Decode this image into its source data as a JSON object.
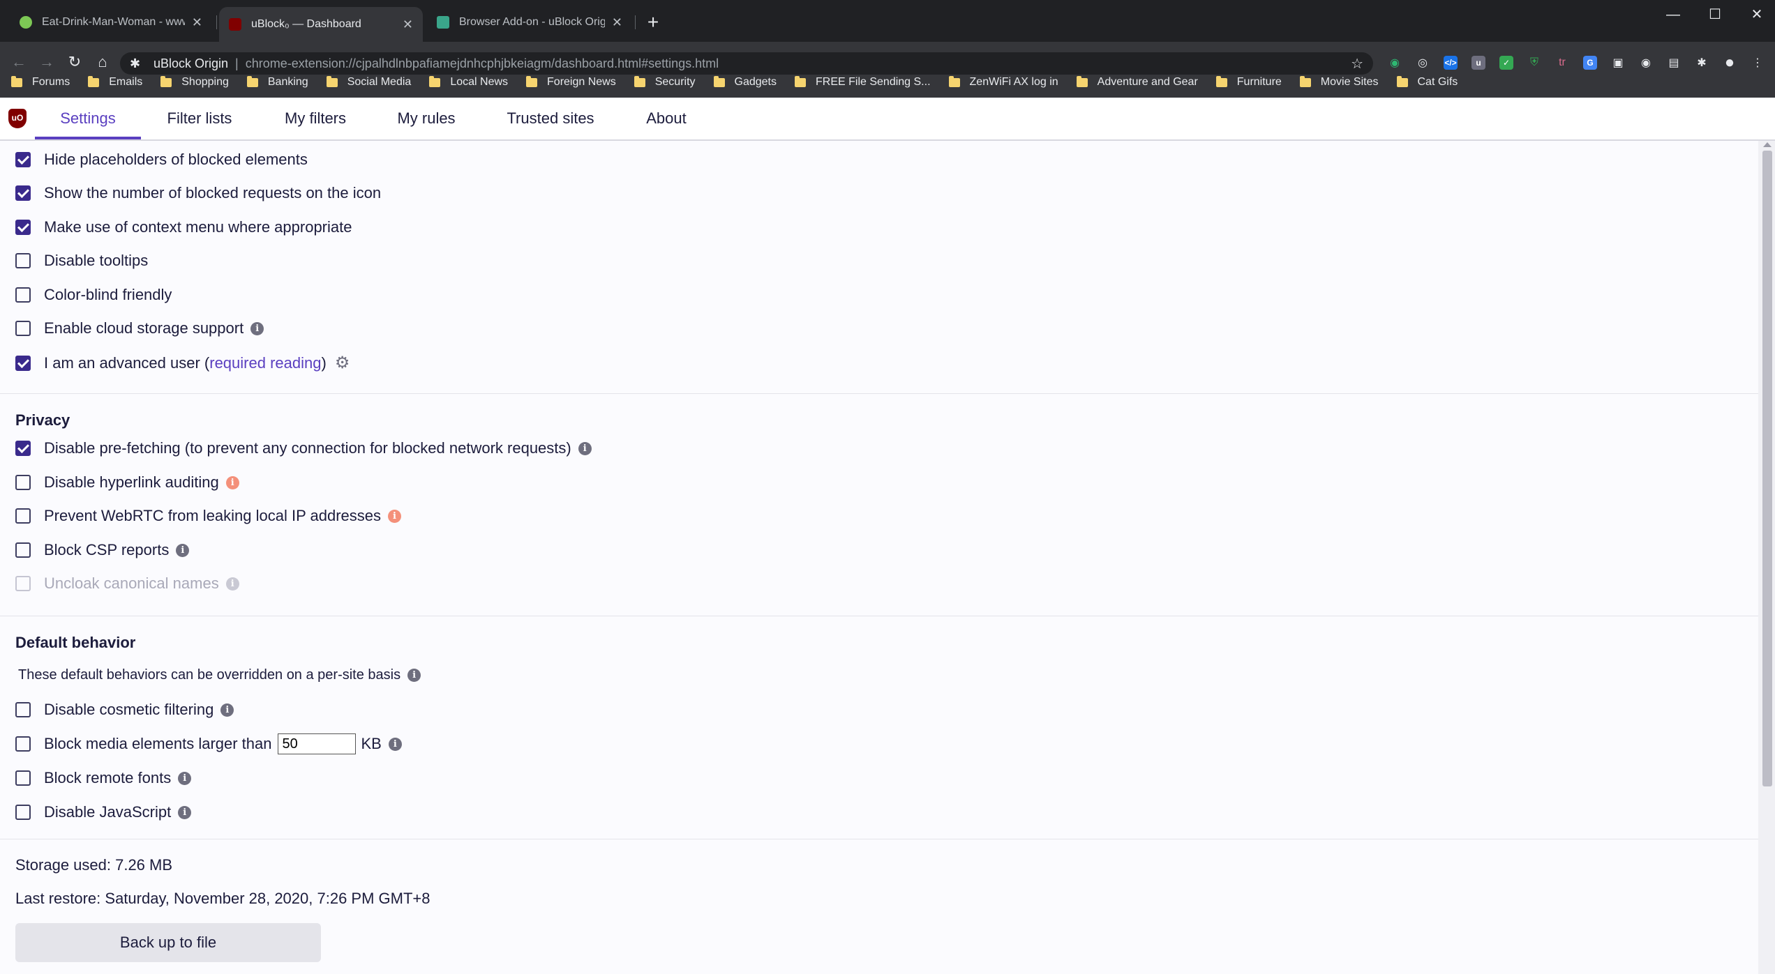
{
  "browser": {
    "tabs": [
      {
        "title": "Eat-Drink-Man-Woman - www.h...",
        "active": false
      },
      {
        "title": "uBlock₀ — Dashboard",
        "active": true
      },
      {
        "title": "Browser Add-on - uBlock Origin",
        "active": false
      }
    ],
    "new_tab": "+",
    "window_controls": {
      "minimize": "—",
      "maximize": "☐",
      "close": "✕"
    },
    "omnibox": {
      "site": "uBlock Origin",
      "divider": "|",
      "url": "chrome-extension://cjpalhdlnbpafiamejdnhcphjbkeiagm/dashboard.html#settings.html"
    },
    "bookmarks": [
      "Forums",
      "Emails",
      "Shopping",
      "Banking",
      "Social Media",
      "Local News",
      "Foreign News",
      "Security",
      "Gadgets",
      "FREE File Sending S...",
      "ZenWiFi AX log in",
      "Adventure and Gear",
      "Furniture",
      "Movie Sites",
      "Cat Gifs"
    ]
  },
  "dashboard": {
    "logo": "uO",
    "tabs": [
      {
        "label": "Settings",
        "active": true
      },
      {
        "label": "Filter lists",
        "active": false
      },
      {
        "label": "My filters",
        "active": false
      },
      {
        "label": "My rules",
        "active": false
      },
      {
        "label": "Trusted sites",
        "active": false
      },
      {
        "label": "About",
        "active": false
      }
    ]
  },
  "appearance": {
    "options": [
      {
        "label": "Hide placeholders of blocked elements",
        "checked": true
      },
      {
        "label": "Show the number of blocked requests on the icon",
        "checked": true
      },
      {
        "label": "Make use of context menu where appropriate",
        "checked": true
      },
      {
        "label": "Disable tooltips",
        "checked": false
      },
      {
        "label": "Color-blind friendly",
        "checked": false
      },
      {
        "label": "Enable cloud storage support",
        "checked": false
      },
      {
        "label": "I am an advanced user (",
        "link": "required reading",
        "suffix": ")",
        "checked": true
      }
    ]
  },
  "privacy": {
    "heading": "Privacy",
    "options": [
      {
        "label": "Disable pre-fetching (to prevent any connection for blocked network requests)",
        "checked": true
      },
      {
        "label": "Disable hyperlink auditing",
        "checked": false
      },
      {
        "label": "Prevent WebRTC from leaking local IP addresses",
        "checked": false
      },
      {
        "label": "Block CSP reports",
        "checked": false
      },
      {
        "label": "Uncloak canonical names",
        "checked": false,
        "disabled": true
      }
    ]
  },
  "default_behavior": {
    "heading": "Default behavior",
    "note": "These default behaviors can be overridden on a per-site basis",
    "options": [
      {
        "label": "Disable cosmetic filtering",
        "checked": false
      },
      {
        "label": "Block media elements larger than",
        "value": "50",
        "unit": "KB",
        "checked": false
      },
      {
        "label": "Block remote fonts",
        "checked": false
      },
      {
        "label": "Disable JavaScript",
        "checked": false
      }
    ]
  },
  "storage": {
    "used": "Storage used: 7.26 MB",
    "last_restore": "Last restore: Saturday, November 28, 2020, 7:26 PM GMT+8",
    "backup_button": "Back up to file"
  }
}
